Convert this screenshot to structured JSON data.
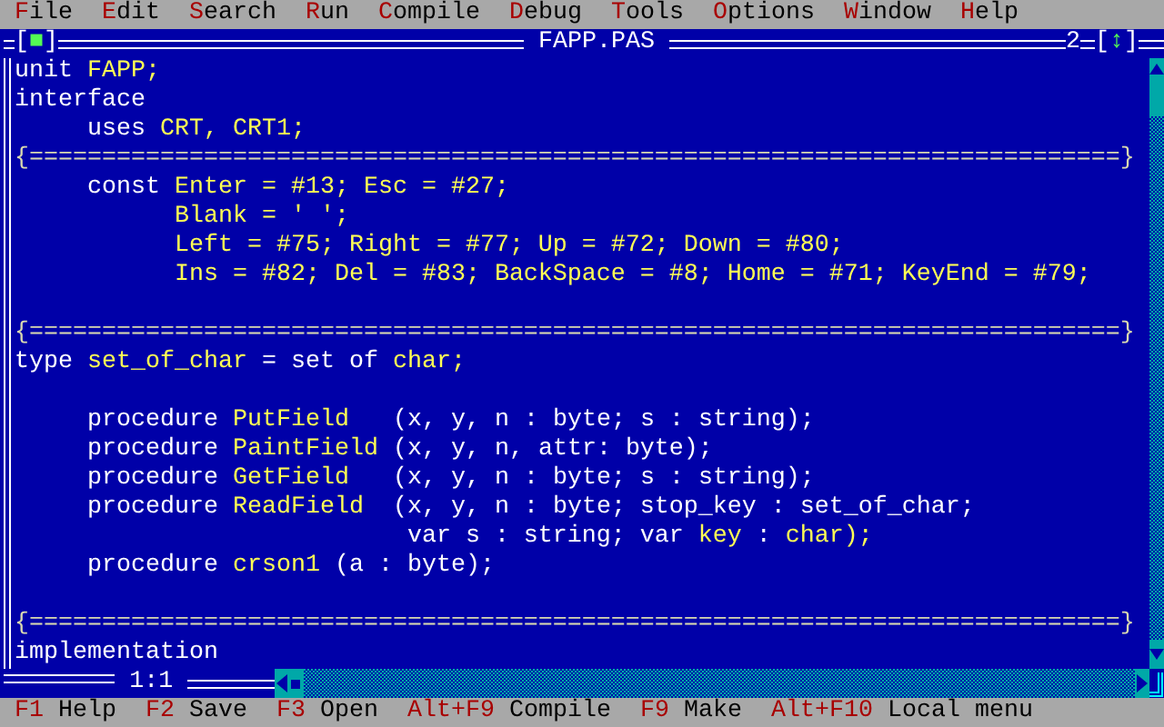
{
  "menu_bar": [
    {
      "hotkey": "F",
      "rest": "ile"
    },
    {
      "hotkey": "E",
      "rest": "dit"
    },
    {
      "hotkey": "S",
      "rest": "earch"
    },
    {
      "hotkey": "R",
      "rest": "un"
    },
    {
      "hotkey": "C",
      "rest": "ompile"
    },
    {
      "hotkey": "D",
      "rest": "ebug"
    },
    {
      "hotkey": "T",
      "rest": "ools"
    },
    {
      "hotkey": "O",
      "rest": "ptions"
    },
    {
      "hotkey": "W",
      "rest": "indow"
    },
    {
      "hotkey": "H",
      "rest": "elp"
    }
  ],
  "window": {
    "title": "FAPP.PAS",
    "number": "2",
    "close_box": {
      "left": "[",
      "glyph": "■",
      "right": "]"
    },
    "zoom_box": {
      "left": "[",
      "glyph": "↕",
      "right": "]"
    },
    "cursor_position": "1:1"
  },
  "editor": {
    "lines": [
      {
        "kind": "code",
        "segments": [
          {
            "text": "unit ",
            "kind": "keyword"
          },
          {
            "text": "FAPP;",
            "kind": "identifier"
          }
        ]
      },
      {
        "kind": "code",
        "segments": [
          {
            "text": "interface",
            "kind": "keyword"
          }
        ]
      },
      {
        "kind": "code",
        "segments": [
          {
            "text": "     uses ",
            "kind": "keyword"
          },
          {
            "text": "CRT, CRT1;",
            "kind": "identifier"
          }
        ]
      },
      {
        "kind": "code",
        "segments": [
          {
            "text": "{===========================================================================}",
            "kind": "comment"
          }
        ]
      },
      {
        "kind": "code",
        "segments": [
          {
            "text": "     const ",
            "kind": "keyword"
          },
          {
            "text": "Enter = #13; Esc = #27;",
            "kind": "identifier"
          }
        ]
      },
      {
        "kind": "code",
        "segments": [
          {
            "text": "           Blank = ' ';",
            "kind": "identifier"
          }
        ]
      },
      {
        "kind": "code",
        "segments": [
          {
            "text": "           Left = #75; Right = #77; Up = #72; Down = #80;",
            "kind": "identifier"
          }
        ]
      },
      {
        "kind": "code",
        "segments": [
          {
            "text": "           Ins = #82; Del = #83; BackSpace = #8; Home = #71; KeyEnd = #79;",
            "kind": "identifier"
          }
        ]
      },
      {
        "kind": "blank"
      },
      {
        "kind": "code",
        "segments": [
          {
            "text": "{===========================================================================}",
            "kind": "comment"
          }
        ]
      },
      {
        "kind": "code",
        "segments": [
          {
            "text": "type ",
            "kind": "keyword"
          },
          {
            "text": "set_of_char",
            "kind": "identifier"
          },
          {
            "text": " = set of ",
            "kind": "keyword"
          },
          {
            "text": "char;",
            "kind": "identifier"
          }
        ]
      },
      {
        "kind": "blank"
      },
      {
        "kind": "code",
        "segments": [
          {
            "text": "     procedure ",
            "kind": "keyword"
          },
          {
            "text": "PutField",
            "kind": "identifier"
          },
          {
            "text": "   (x, y, n : byte; s : string);",
            "kind": "keyword"
          }
        ]
      },
      {
        "kind": "code",
        "segments": [
          {
            "text": "     procedure ",
            "kind": "keyword"
          },
          {
            "text": "PaintField",
            "kind": "identifier"
          },
          {
            "text": " (x, y, n, attr: byte);",
            "kind": "keyword"
          }
        ]
      },
      {
        "kind": "code",
        "segments": [
          {
            "text": "     procedure ",
            "kind": "keyword"
          },
          {
            "text": "GetField",
            "kind": "identifier"
          },
          {
            "text": "   (x, y, n : byte; s : string);",
            "kind": "keyword"
          }
        ]
      },
      {
        "kind": "code",
        "segments": [
          {
            "text": "     procedure ",
            "kind": "keyword"
          },
          {
            "text": "ReadField",
            "kind": "identifier"
          },
          {
            "text": "  (x, y, n : byte; stop_key : set_of_char;",
            "kind": "keyword"
          }
        ]
      },
      {
        "kind": "code",
        "segments": [
          {
            "text": "                           var s : string; var ",
            "kind": "keyword"
          },
          {
            "text": "key",
            "kind": "identifier"
          },
          {
            "text": " : ",
            "kind": "keyword"
          },
          {
            "text": "char);",
            "kind": "identifier"
          }
        ]
      },
      {
        "kind": "code",
        "segments": [
          {
            "text": "     procedure ",
            "kind": "keyword"
          },
          {
            "text": "crson1",
            "kind": "identifier"
          },
          {
            "text": " (a : byte);",
            "kind": "keyword"
          }
        ]
      },
      {
        "kind": "blank"
      },
      {
        "kind": "code",
        "segments": [
          {
            "text": "{===========================================================================}",
            "kind": "comment"
          }
        ]
      },
      {
        "kind": "code",
        "segments": [
          {
            "text": "implementation",
            "kind": "keyword"
          }
        ]
      }
    ]
  },
  "status_bar": [
    {
      "key": "F1",
      "label": "Help"
    },
    {
      "key": "F2",
      "label": "Save"
    },
    {
      "key": "F3",
      "label": "Open"
    },
    {
      "key": "Alt+F9",
      "label": "Compile"
    },
    {
      "key": "F9",
      "label": "Make"
    },
    {
      "key": "Alt+F10",
      "label": "Local menu"
    }
  ]
}
